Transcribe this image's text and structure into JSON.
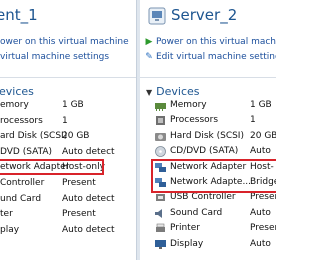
{
  "left_vm": {
    "title": "ent_1",
    "actions": [
      {
        "label": "ower on this virtual machine",
        "icon": "play-icon"
      },
      {
        "label": "virtual machine settings",
        "icon": "settings-icon"
      }
    ],
    "devices_heading": "evices",
    "devices": [
      {
        "name": "emory",
        "value": "1 GB"
      },
      {
        "name": "rocessors",
        "value": "1"
      },
      {
        "name": "ard Disk (SCSI)",
        "value": "20 GB"
      },
      {
        "name": "DVD (SATA)",
        "value": "Auto detect"
      },
      {
        "name": "etwork Adapter",
        "value": "Host-only",
        "highlighted": true
      },
      {
        "name": "Controller",
        "value": "Present"
      },
      {
        "name": "und Card",
        "value": "Auto detect"
      },
      {
        "name": "ter",
        "value": "Present"
      },
      {
        "name": "play",
        "value": "Auto detect"
      }
    ]
  },
  "right_vm": {
    "title": "Server_2",
    "actions": [
      {
        "label": "Power on this virtual machine",
        "icon": "play-icon"
      },
      {
        "label": "Edit virtual machine settings",
        "icon": "settings-icon"
      }
    ],
    "devices_heading": "Devices",
    "devices": [
      {
        "name": "Memory",
        "value": "1 GB",
        "icon": "memory-icon"
      },
      {
        "name": "Processors",
        "value": "1",
        "icon": "cpu-icon"
      },
      {
        "name": "Hard Disk (SCSI)",
        "value": "20 GB",
        "icon": "disk-icon"
      },
      {
        "name": "CD/DVD (SATA)",
        "value": "Auto",
        "icon": "cd-icon"
      },
      {
        "name": "Network Adapter",
        "value": "Host-",
        "icon": "network-icon",
        "highlighted": true
      },
      {
        "name": "Network Adapte...",
        "value": "Bridge",
        "icon": "network-icon",
        "highlighted": true
      },
      {
        "name": "USB Controller",
        "value": "Presen",
        "icon": "usb-icon"
      },
      {
        "name": "Sound Card",
        "value": "Auto",
        "icon": "sound-icon"
      },
      {
        "name": "Printer",
        "value": "Presen",
        "icon": "printer-icon"
      },
      {
        "name": "Display",
        "value": "Auto",
        "icon": "display-icon"
      }
    ]
  }
}
